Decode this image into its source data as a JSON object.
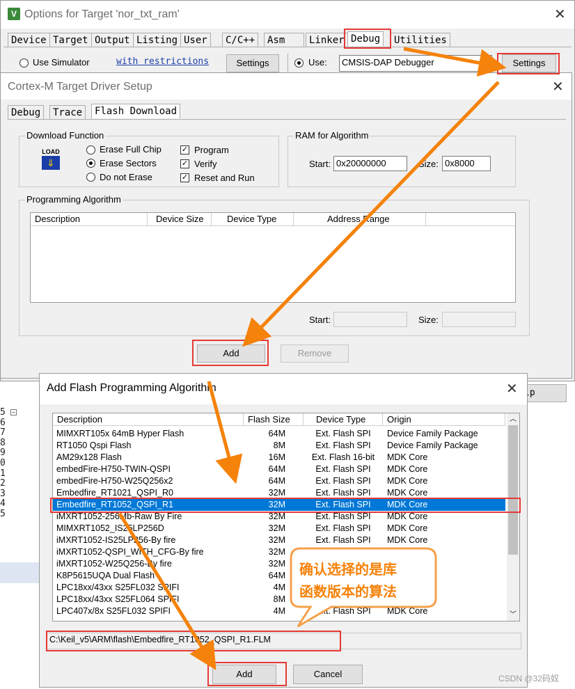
{
  "options_window": {
    "title": "Options for Target 'nor_txt_ram'",
    "tabs": [
      "Device",
      "Target",
      "Output",
      "Listing",
      "User",
      "C/C++",
      "Asm",
      "Linker",
      "Debug",
      "Utilities"
    ],
    "use_simulator": "Use Simulator",
    "with_restrictions": "with restrictions",
    "settings": "Settings",
    "use": "Use:",
    "debugger": "CMSIS-DAP Debugger",
    "settings_right": "Settings"
  },
  "driver_window": {
    "title": "Cortex-M Target Driver Setup",
    "tabs": [
      "Debug",
      "Trace",
      "Flash Download"
    ],
    "download_function": "Download Function",
    "load_icon_text": "LOAD",
    "erase_full_chip": "Erase Full Chip",
    "erase_sectors": "Erase Sectors",
    "do_not_erase": "Do not Erase",
    "program": "Program",
    "verify": "Verify",
    "reset_and_run": "Reset and Run",
    "ram_for_algorithm": "RAM for Algorithm",
    "start_label": "Start:",
    "start_value": "0x20000000",
    "size_label": "Size:",
    "size_value": "0x8000",
    "programming_algorithm": "Programming Algorithm",
    "columns": [
      "Description",
      "Device Size",
      "Device Type",
      "Address Range"
    ],
    "start2_label": "Start:",
    "size2_label": "Size:",
    "add": "Add",
    "remove": "Remove",
    "help_fragment": "lp"
  },
  "add_window": {
    "title": "Add Flash Programming Algorithm",
    "columns": [
      "Description",
      "Flash Size",
      "Device Type",
      "Origin"
    ],
    "rows": [
      {
        "desc": "MIMXRT105x 64mB Hyper Flash",
        "size": "64M",
        "type": "Ext. Flash SPI",
        "origin": "Device Family Package"
      },
      {
        "desc": "RT1050 Qspi Flash",
        "size": "8M",
        "type": "Ext. Flash SPI",
        "origin": "Device Family Package"
      },
      {
        "desc": "AM29x128 Flash",
        "size": "16M",
        "type": "Ext. Flash 16-bit",
        "origin": "MDK Core"
      },
      {
        "desc": "embedFire-H750-TWIN-QSPI",
        "size": "64M",
        "type": "Ext. Flash SPI",
        "origin": "MDK Core"
      },
      {
        "desc": "embedFire-H750-W25Q256x2",
        "size": "64M",
        "type": "Ext. Flash SPI",
        "origin": "MDK Core"
      },
      {
        "desc": "Embedfire_RT1021_QSPI_R0",
        "size": "32M",
        "type": "Ext. Flash SPI",
        "origin": "MDK Core"
      },
      {
        "desc": "Embedfire_RT1052_QSPI_R1",
        "size": "32M",
        "type": "Ext. Flash SPI",
        "origin": "MDK Core"
      },
      {
        "desc": "iMXRT1052-256Mb-Raw By Fire",
        "size": "32M",
        "type": "Ext. Flash SPI",
        "origin": "MDK Core"
      },
      {
        "desc": "MIMXRT1052_IS25LP256D",
        "size": "32M",
        "type": "Ext. Flash SPI",
        "origin": "MDK Core"
      },
      {
        "desc": "iMXRT1052-IS25LP256-By fire",
        "size": "32M",
        "type": "Ext. Flash SPI",
        "origin": "MDK Core"
      },
      {
        "desc": "iMXRT1052-QSPI_WITH_CFG-By fire",
        "size": "32M",
        "type": "",
        "origin": ""
      },
      {
        "desc": "iMXRT1052-W25Q256-By fire",
        "size": "32M",
        "type": "",
        "origin": ""
      },
      {
        "desc": "K8P5615UQA Dual Flash",
        "size": "64M",
        "type": "",
        "origin": ""
      },
      {
        "desc": "LPC18xx/43xx S25FL032 SPIFI",
        "size": "4M",
        "type": "",
        "origin": ""
      },
      {
        "desc": "LPC18xx/43xx S25FL064 SPIFI",
        "size": "8M",
        "type": "",
        "origin": ""
      },
      {
        "desc": "LPC407x/8x S25FL032 SPIFI",
        "size": "4M",
        "type": "Ext. Flash SPI",
        "origin": "MDK Core"
      }
    ],
    "path": "C:\\Keil_v5\\ARM\\flash\\Embedfire_RT1052_QSPI_R1.FLM",
    "add": "Add",
    "cancel": "Cancel"
  },
  "callout": {
    "line1": "确认选择的是库",
    "line2": "函数版本的算法"
  },
  "editor_lines": [
    "5",
    "6",
    "7",
    "8",
    "9",
    "0",
    "1",
    "2",
    "3",
    "4",
    "5"
  ],
  "watermark": "CSDN @32码奴",
  "colors": {
    "accent": "#f5820a",
    "red": "#e53935",
    "selection": "#0078d7"
  }
}
